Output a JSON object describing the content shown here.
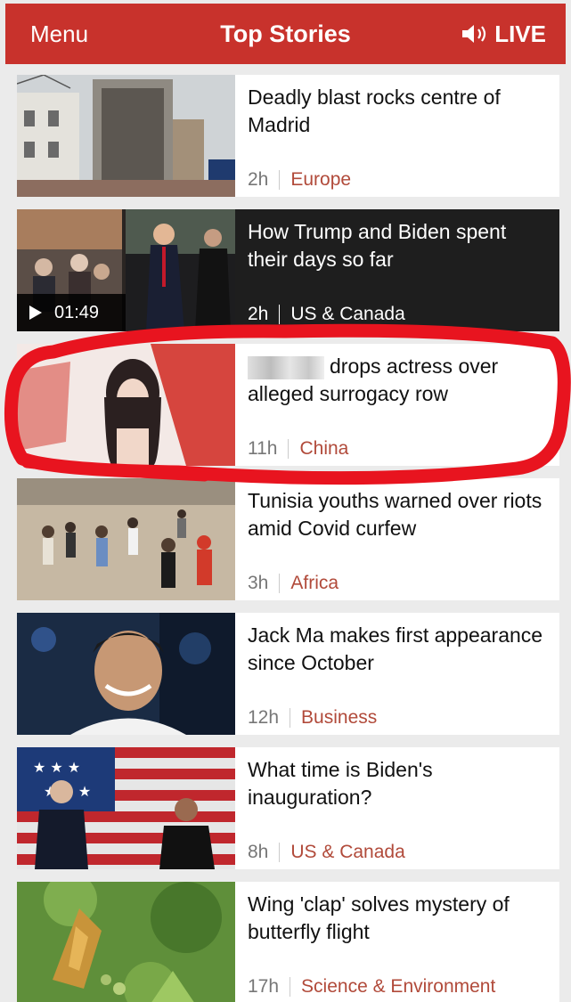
{
  "header": {
    "menu_label": "Menu",
    "title": "Top Stories",
    "live_label": "LIVE",
    "background": "#c8322c"
  },
  "stories": [
    {
      "headline": "Deadly blast rocks centre of Madrid",
      "time": "2h",
      "category": "Europe"
    },
    {
      "headline": "How Trump and Biden spent their days so far",
      "time": "2h",
      "category": "US & Canada",
      "video_duration": "01:49"
    },
    {
      "headline": "drops actress over alleged surrogacy row",
      "time": "11h",
      "category": "China"
    },
    {
      "headline": "Tunisia youths warned over riots amid Covid curfew",
      "time": "3h",
      "category": "Africa"
    },
    {
      "headline": "Jack Ma makes first appearance since October",
      "time": "12h",
      "category": "Business"
    },
    {
      "headline": "What time is Biden's inauguration?",
      "time": "8h",
      "category": "US & Canada"
    },
    {
      "headline": "Wing 'clap' solves mystery of butterfly flight",
      "time": "17h",
      "category": "Science & Environment"
    }
  ],
  "icons": {
    "live": "speaker-icon",
    "video": "play-icon"
  },
  "colors": {
    "category": "#b14a3a",
    "annotation": "#e8141f"
  }
}
